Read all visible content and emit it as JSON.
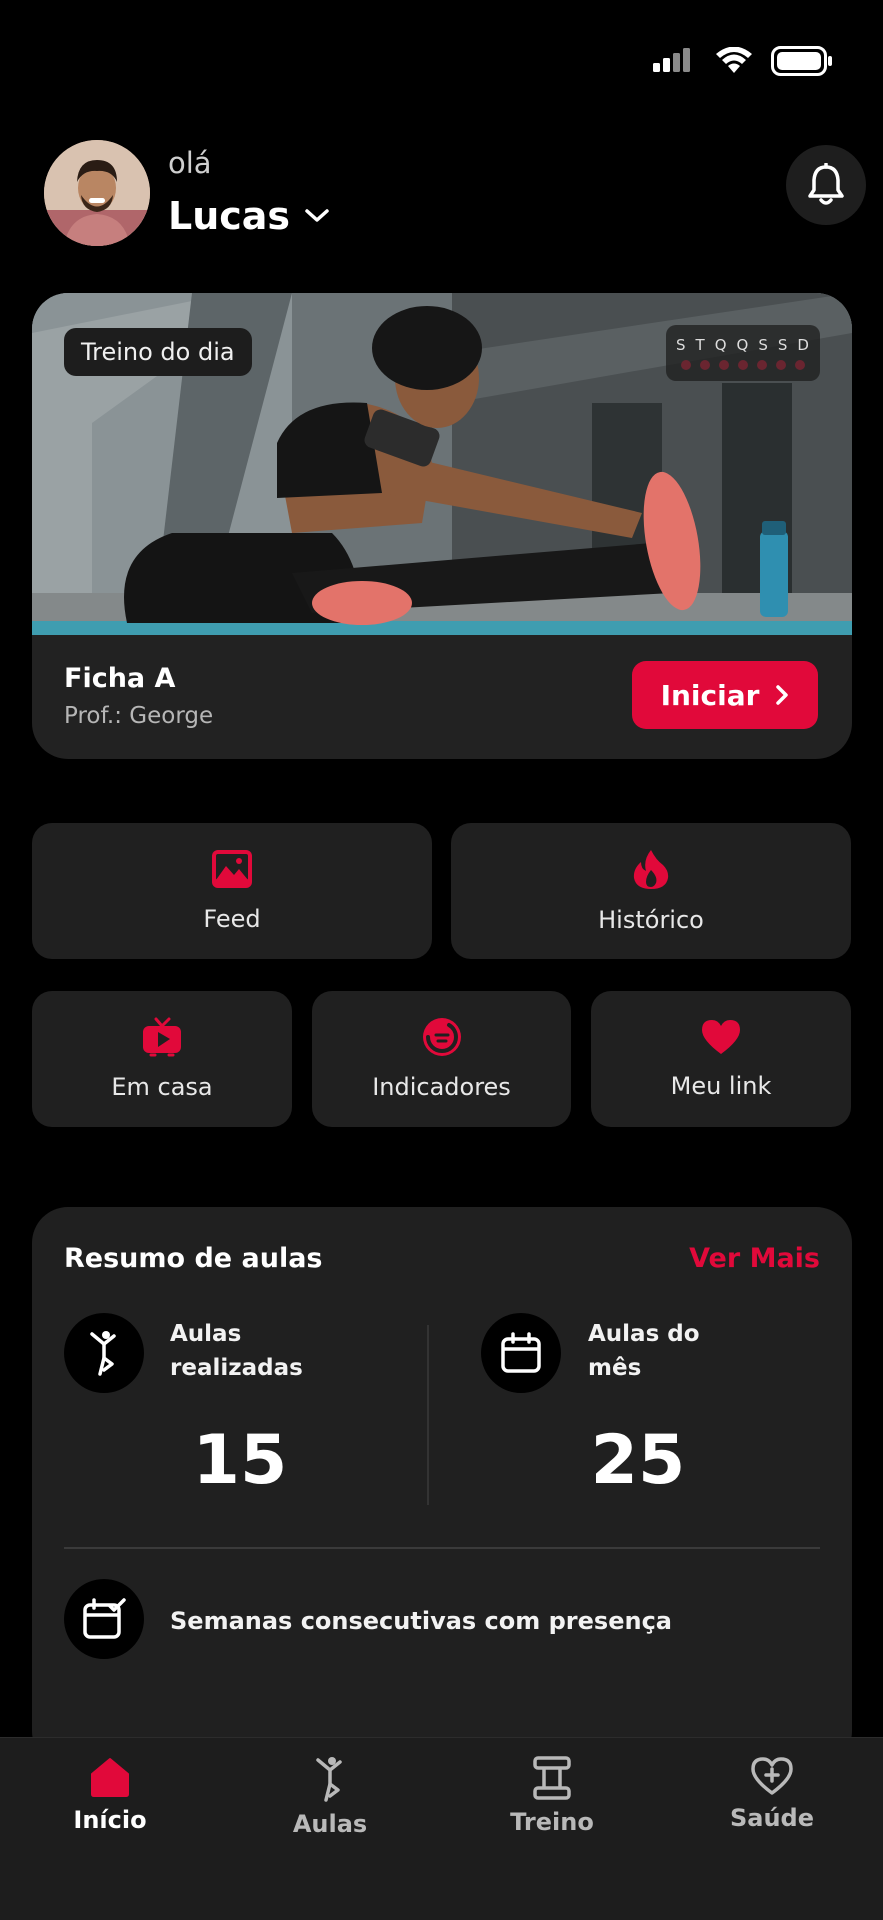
{
  "header": {
    "greeting": "olá",
    "user_name": "Lucas"
  },
  "hero": {
    "tag": "Treino do dia",
    "week_days": [
      "S",
      "T",
      "Q",
      "Q",
      "S",
      "S",
      "D"
    ],
    "workout_name": "Ficha A",
    "instructor": "Prof.: George",
    "start_label": "Iniciar"
  },
  "shortcuts": {
    "feed": "Feed",
    "history": "Histórico",
    "home": "Em casa",
    "indicators": "Indicadores",
    "my_link": "Meu link"
  },
  "summary": {
    "title": "Resumo de aulas",
    "see_more": "Ver Mais",
    "done_label_1": "Aulas",
    "done_label_2": "realizadas",
    "done_value": "15",
    "month_label_1": "Aulas do",
    "month_label_2": "mês",
    "month_value": "25",
    "streak_label": "Semanas consecutivas com presença"
  },
  "nav": {
    "home": "Início",
    "classes": "Aulas",
    "workout": "Treino",
    "health": "Saúde"
  },
  "colors": {
    "accent": "#e1093a",
    "card": "#202020",
    "background": "#000000"
  }
}
